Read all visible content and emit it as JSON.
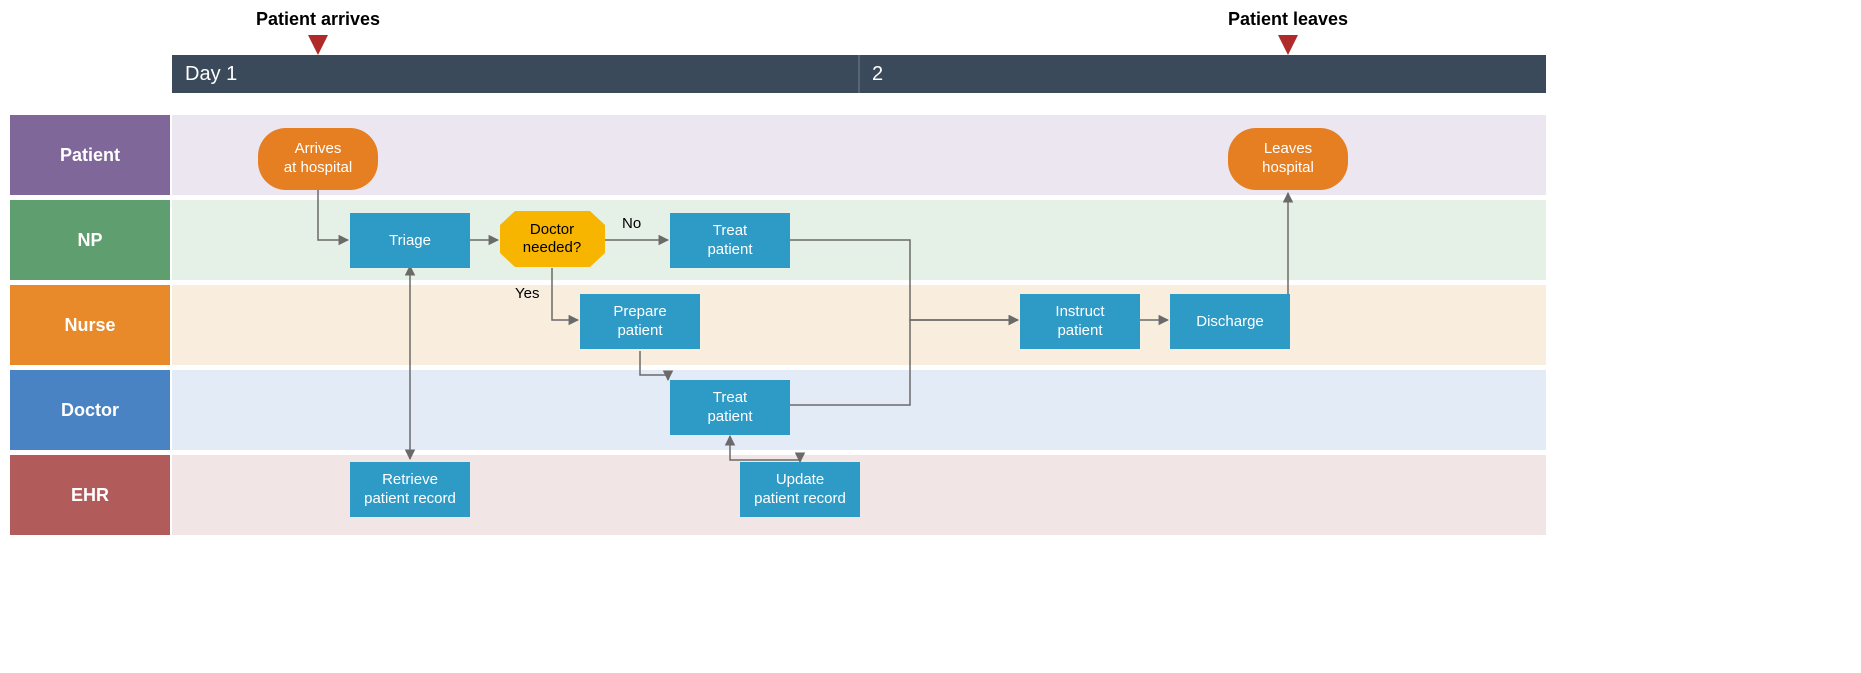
{
  "timeline": {
    "day1_label": "Day 1",
    "day2_label": "2",
    "milestone_arrive": "Patient arrives",
    "milestone_leave": "Patient leaves"
  },
  "lanes": {
    "patient": "Patient",
    "np": "NP",
    "nurse": "Nurse",
    "doctor": "Doctor",
    "ehr": "EHR"
  },
  "nodes": {
    "arrive_l1": "Arrives",
    "arrive_l2": "at hospital",
    "triage": "Triage",
    "decision_l1": "Doctor",
    "decision_l2": "needed?",
    "treat_np_l1": "Treat",
    "treat_np_l2": "patient",
    "prepare_l1": "Prepare",
    "prepare_l2": "patient",
    "treat_dr_l1": "Treat",
    "treat_dr_l2": "patient",
    "instruct_l1": "Instruct",
    "instruct_l2": "patient",
    "discharge": "Discharge",
    "leave_l1": "Leaves",
    "leave_l2": "hospital",
    "retrieve_l1": "Retrieve",
    "retrieve_l2": "patient record",
    "update_l1": "Update",
    "update_l2": "patient record"
  },
  "edges": {
    "no": "No",
    "yes": "Yes"
  },
  "colors": {
    "timeline_bar": "#3b4a5a",
    "lane_patient_header": "#7f6899",
    "lane_patient_bg": "#ece6f0",
    "lane_np_header": "#5f9e6e",
    "lane_np_bg": "#e5f0e6",
    "lane_nurse_header": "#e88a2a",
    "lane_nurse_bg": "#f9eddd",
    "lane_doctor_header": "#4983c3",
    "lane_doctor_bg": "#e3ecf6",
    "lane_ehr_header": "#b15b5b",
    "lane_ehr_bg": "#f2e5e5",
    "task": "#2e9ac6",
    "terminator": "#e67e22",
    "decision": "#f7b500",
    "marker": "#b02a2a",
    "arrow": "#6a6a6a"
  }
}
